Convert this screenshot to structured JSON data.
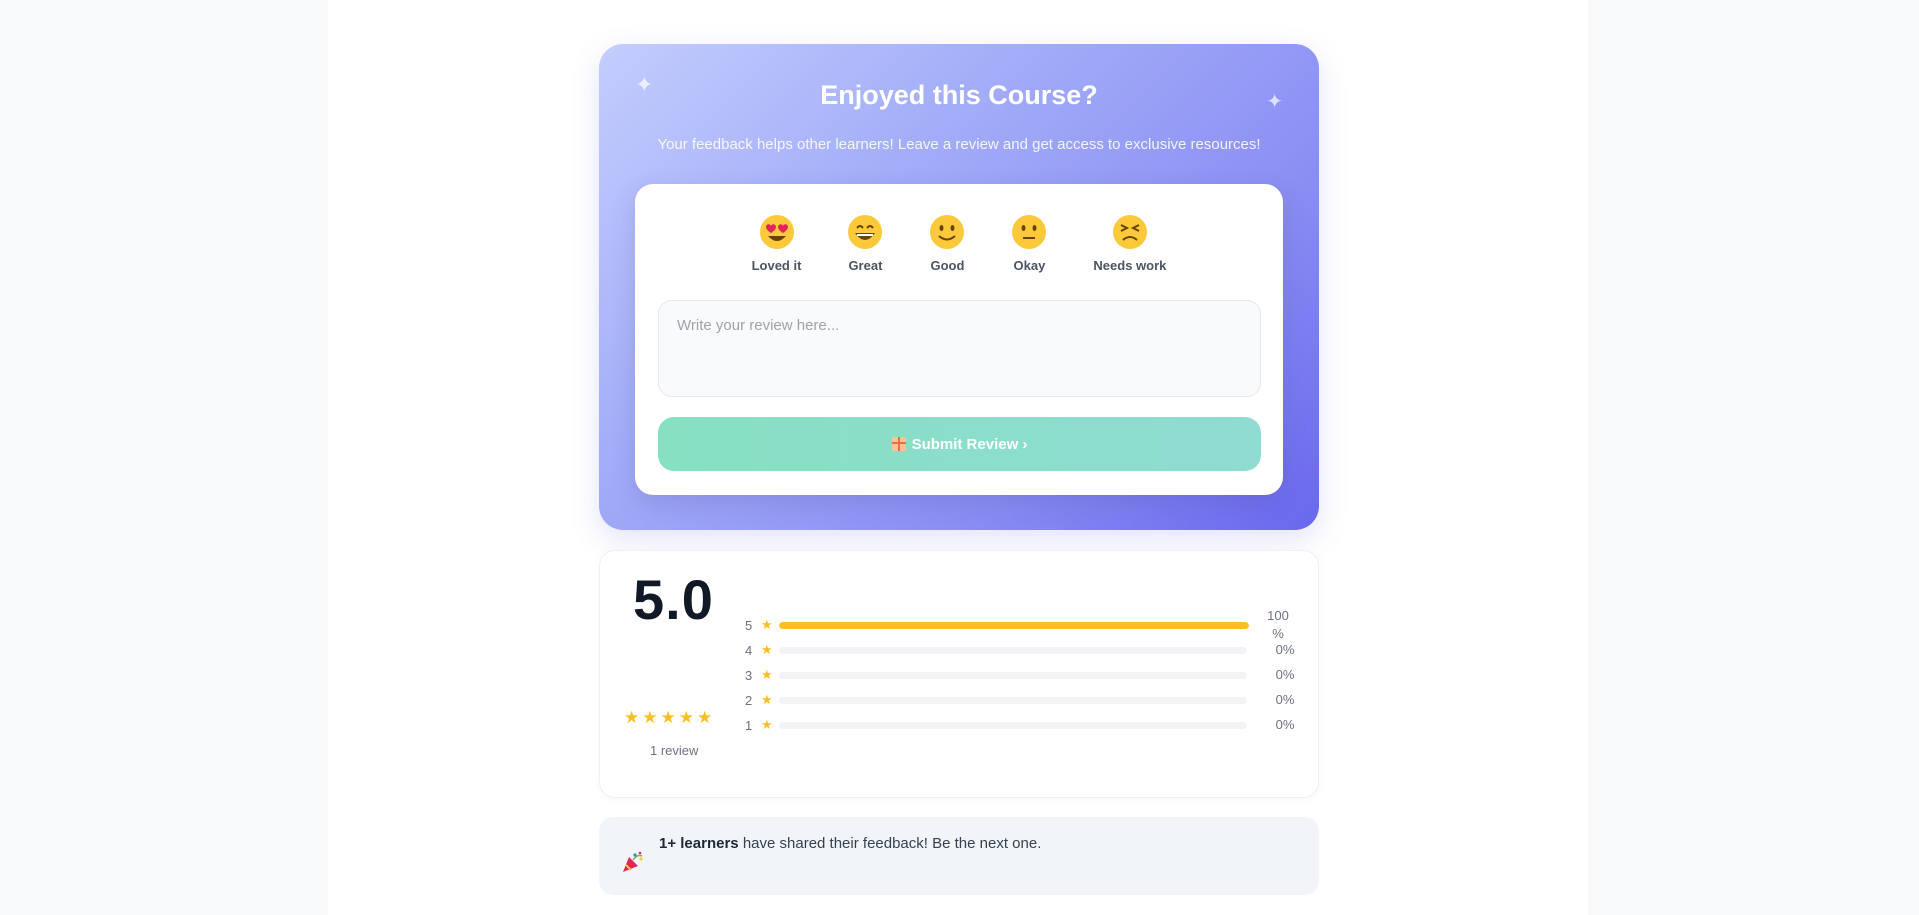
{
  "hero": {
    "title": "Enjoyed this Course?",
    "subtitle": "Your feedback helps other learners! Leave a review and get access to exclusive resources!",
    "emojis": [
      {
        "label": "Loved it",
        "icon": "heart-eyes-face-icon"
      },
      {
        "label": "Great",
        "icon": "grinning-face-icon"
      },
      {
        "label": "Good",
        "icon": "smiling-face-icon"
      },
      {
        "label": "Okay",
        "icon": "neutral-face-icon"
      },
      {
        "label": "Needs work",
        "icon": "persevering-face-icon"
      }
    ],
    "review_placeholder": "Write your review here...",
    "submit_label": "Submit Review ›"
  },
  "rating": {
    "score": "5.0",
    "stars": 5,
    "review_count": "1 review",
    "breakdown": [
      {
        "stars": "5",
        "percent": 100,
        "percent_label": "100 %"
      },
      {
        "stars": "4",
        "percent": 0,
        "percent_label": "0%"
      },
      {
        "stars": "3",
        "percent": 0,
        "percent_label": "0%"
      },
      {
        "stars": "2",
        "percent": 0,
        "percent_label": "0%"
      },
      {
        "stars": "1",
        "percent": 0,
        "percent_label": "0%"
      }
    ]
  },
  "banner": {
    "count": "1+ learners",
    "text": " have shared their feedback! Be the next one."
  },
  "colors": {
    "accent": "#6a67ee",
    "star": "#fbbf24",
    "submit": "#86e0c2"
  }
}
